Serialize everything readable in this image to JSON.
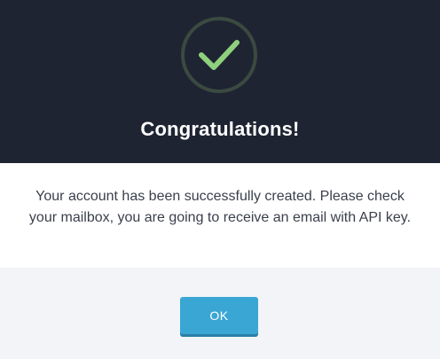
{
  "dialog": {
    "title": "Congratulations!",
    "message": "Your account has been successfully created. Please check your mailbox, you are going to receive an email with API key.",
    "ok_label": "OK",
    "icon": "checkmark-circle-icon",
    "colors": {
      "header_bg": "#1f2433",
      "check": "#8fd07c",
      "circle": "#3b4a40",
      "button": "#3aa6d4",
      "footer_bg": "#f2f4f7"
    }
  }
}
